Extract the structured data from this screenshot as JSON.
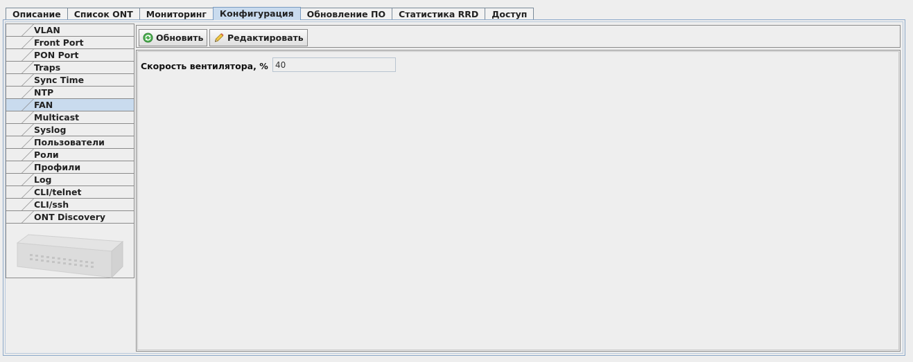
{
  "tabs": [
    {
      "label": "Описание"
    },
    {
      "label": "Список ONT"
    },
    {
      "label": "Мониторинг"
    },
    {
      "label": "Конфигурация",
      "active": true
    },
    {
      "label": "Обновление ПО"
    },
    {
      "label": "Статистика RRD"
    },
    {
      "label": "Доступ"
    }
  ],
  "sidebar": {
    "items": [
      {
        "label": "VLAN"
      },
      {
        "label": "Front Port"
      },
      {
        "label": "PON Port"
      },
      {
        "label": "Traps"
      },
      {
        "label": "Sync Time"
      },
      {
        "label": "NTP"
      },
      {
        "label": "FAN",
        "active": true
      },
      {
        "label": "Multicast"
      },
      {
        "label": "Syslog"
      },
      {
        "label": "Пользователи"
      },
      {
        "label": "Роли"
      },
      {
        "label": "Профили"
      },
      {
        "label": "Log"
      },
      {
        "label": "CLI/telnet"
      },
      {
        "label": "CLI/ssh"
      },
      {
        "label": "ONT Discovery"
      }
    ]
  },
  "toolbar": {
    "refresh_label": "Обновить",
    "refresh_icon": "refresh-icon",
    "edit_label": "Редактировать",
    "edit_icon": "pencil-icon"
  },
  "form": {
    "fan_speed_label": "Скорость вентилятора, %",
    "fan_speed_value": "40"
  },
  "colors": {
    "active_tab": "#c9dbee",
    "frame_border": "#8aa7c8"
  }
}
